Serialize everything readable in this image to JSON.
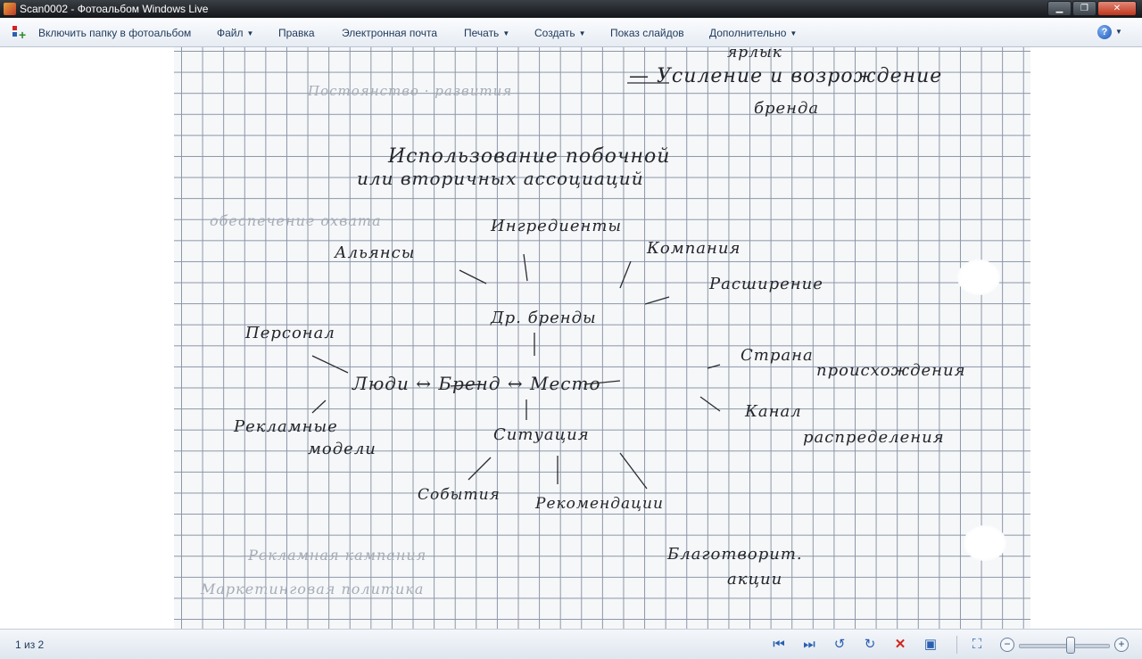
{
  "window": {
    "title": "Scan0002 - Фотоальбом Windows Live",
    "controls": {
      "minimize": "▁",
      "maximize": "❐",
      "close": "✕"
    }
  },
  "menu": {
    "add_folder": "Включить папку в фотоальбом",
    "file": "Файл",
    "edit": "Правка",
    "email": "Электронная почта",
    "print": "Печать",
    "create": "Создать",
    "slideshow": "Показ слайдов",
    "extras": "Дополнительно",
    "help_icon": "help-icon"
  },
  "notes": {
    "lines": [
      "ярлык",
      "— Усиление и возрождение",
      "бренда",
      "Использование побочной",
      "или вторичных ассоциаций",
      "Ингредиенты",
      "Альянсы",
      "Компания",
      "Расширение",
      "Др. бренды",
      "Персонал",
      "Люди ↔ Бренд ↔ Место",
      "Страна",
      "происхождения",
      "Рекламные",
      "модели",
      "Ситуация",
      "Канал",
      "распределения",
      "События",
      "Рекомендации",
      "Благотворит.",
      "акции"
    ]
  },
  "status": {
    "page_counter": "1 из 2",
    "zoom_percent": 58
  },
  "accent": {
    "ink": "#24262b",
    "blue": "#2a5fb0",
    "red": "#d0261e"
  }
}
